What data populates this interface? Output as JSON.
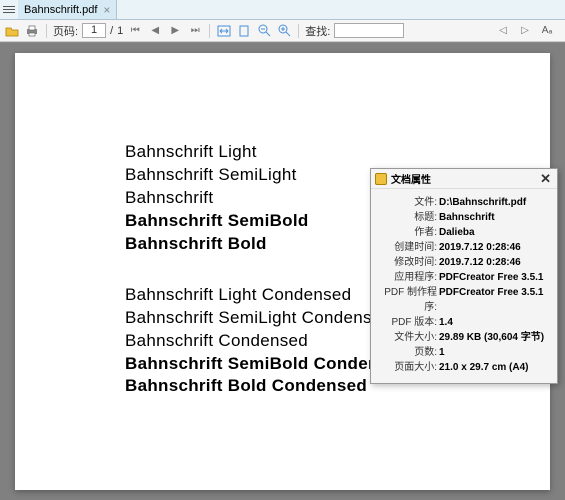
{
  "tab": {
    "title": "Bahnschrift.pdf"
  },
  "toolbar": {
    "page_label": "页码:",
    "page_current": "1",
    "page_sep": "/",
    "page_total": "1",
    "search_label": "查找:"
  },
  "samples": [
    "Bahnschrift Light",
    "Bahnschrift SemiLight",
    "Bahnschrift",
    "Bahnschrift SemiBold",
    "Bahnschrift Bold",
    "Bahnschrift Light Condensed",
    "Bahnschrift SemiLight Condensed",
    "Bahnschrift Condensed",
    "Bahnschrift SemiBold Condensed",
    "Bahnschrift Bold Condensed"
  ],
  "props": {
    "title": "文档属性",
    "rows": {
      "file_l": "文件:",
      "file_v": "D:\\Bahnschrift.pdf",
      "titlel": "标题:",
      "titlev": "Bahnschrift",
      "authl": "作者:",
      "authv": "Dalieba",
      "ctl": "创建时间:",
      "ctv": "2019.7.12 0:28:46",
      "mtl": "修改时间:",
      "mtv": "2019.7.12 0:28:46",
      "appl": "应用程序:",
      "appv": "PDFCreator Free 3.5.1",
      "prodl": "PDF 制作程序:",
      "prodv": "PDFCreator Free 3.5.1",
      "verl": "PDF 版本:",
      "verv": "1.4",
      "sizel": "文件大小:",
      "sizev": "29.89 KB (30,604 字节)",
      "pgl": "页数:",
      "pgv": "1",
      "pszl": "页面大小:",
      "pszv": "21.0 x 29.7 cm (A4)"
    }
  }
}
